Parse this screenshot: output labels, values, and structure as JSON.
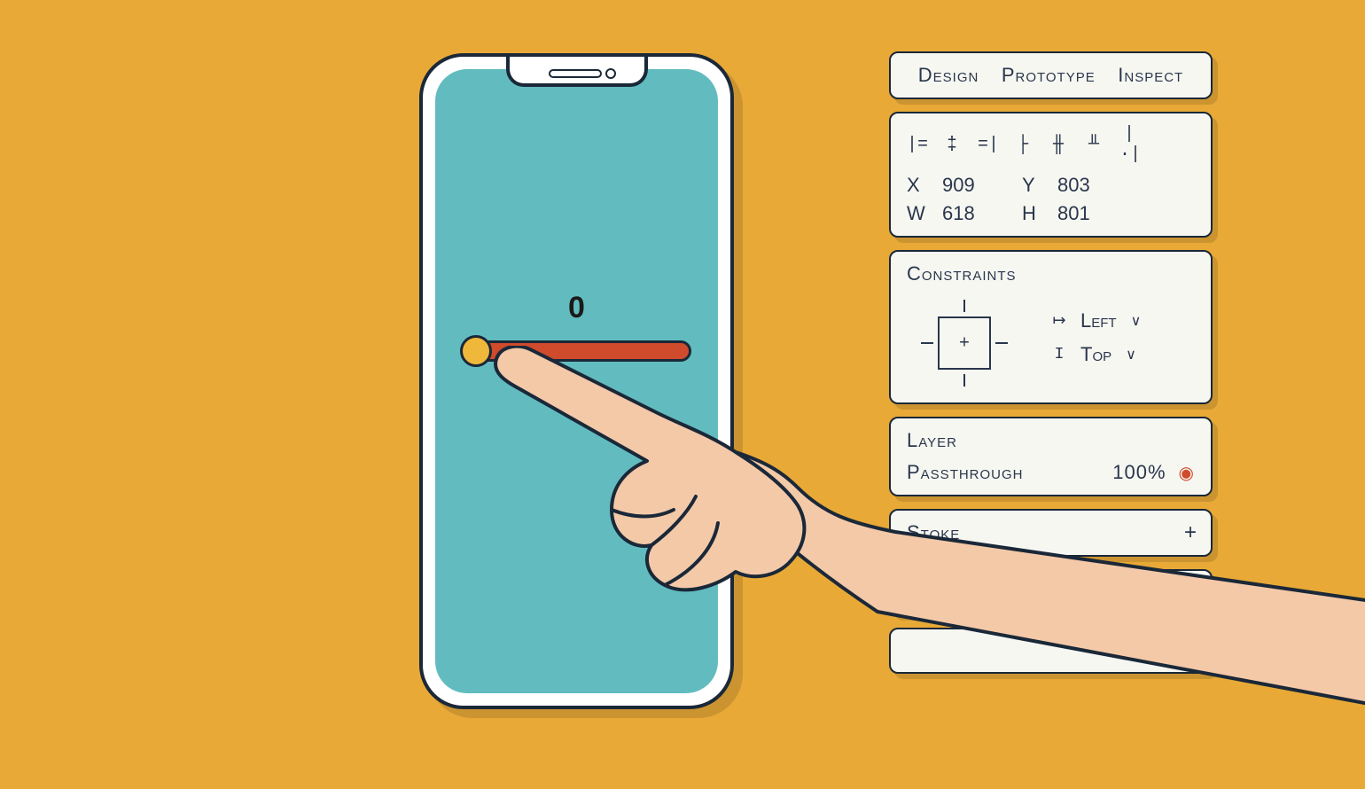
{
  "phone": {
    "slider_value": "0"
  },
  "tabs": {
    "design": "Design",
    "prototype": "Prototype",
    "inspect": "Inspect"
  },
  "align": {
    "g1": "|=",
    "g2": "‡",
    "g3": "=|",
    "g4": "├",
    "g5": "╫",
    "g6": "╨",
    "g7": "|·|"
  },
  "dims": {
    "x_label": "X",
    "x_value": "909",
    "y_label": "Y",
    "y_value": "803",
    "w_label": "W",
    "w_value": "618",
    "h_label": "H",
    "h_value": "801"
  },
  "constraints": {
    "title": "Constraints",
    "horiz_glyph": "↦",
    "horiz_value": "Left",
    "vert_glyph": "I",
    "vert_value": "Top",
    "chev": "∨"
  },
  "layer": {
    "title": "Layer",
    "mode": "Passthrough",
    "opacity": "100%"
  },
  "stroke": {
    "title": "Stoke"
  }
}
